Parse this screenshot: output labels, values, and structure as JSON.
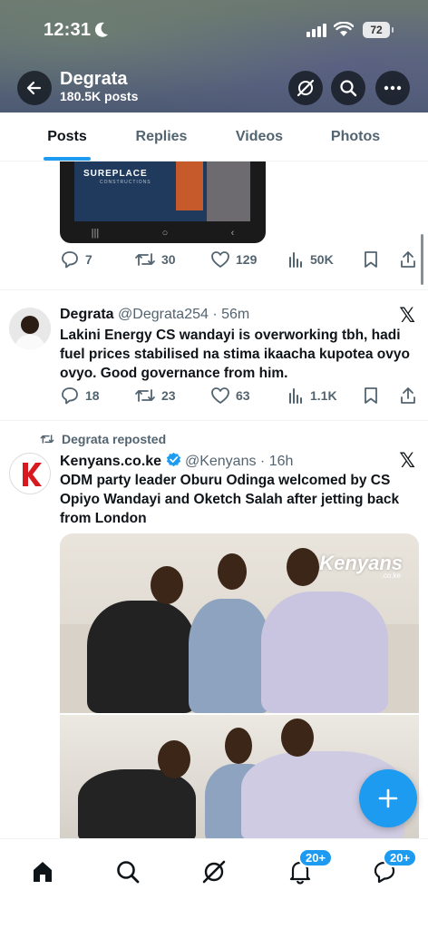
{
  "status_bar": {
    "time": "12:31",
    "battery": "72"
  },
  "profile": {
    "name": "Degrata",
    "posts_count": "180.5K posts"
  },
  "tabs": [
    {
      "label": "Posts",
      "active": true
    },
    {
      "label": "Replies",
      "active": false
    },
    {
      "label": "Videos",
      "active": false
    },
    {
      "label": "Photos",
      "active": false
    }
  ],
  "posts": [
    {
      "embed_brand": "SUREPLACE",
      "embed_sub": "CONSTRUCTIONS",
      "replies": "7",
      "reposts": "30",
      "likes": "129",
      "views": "50K"
    },
    {
      "name": "Degrata",
      "handle": "@Degrata254 · 56m",
      "text": "Lakini Energy CS wandayi is overworking tbh, hadi fuel prices stabilised na stima ikaacha kupotea ovyo ovyo. Good governance from him.",
      "replies": "18",
      "reposts": "23",
      "likes": "63",
      "views": "1.1K"
    },
    {
      "repost_label": "Degrata reposted",
      "name": "Kenyans.co.ke",
      "handle": "@Kenyans · 16h",
      "text": "ODM party leader Oburu Odinga welcomed by CS Opiyo Wandayi and Oketch Salah after jetting back from London",
      "watermark": "Kenyans",
      "watermark_sub": ".co.ke"
    }
  ],
  "bottom_nav": {
    "notifications_badge": "20+",
    "messages_badge": "20+"
  },
  "colors": {
    "accent": "#1d9bf0",
    "text": "#0f1419",
    "muted": "#536471"
  },
  "icons": [
    "back-arrow-icon",
    "grok-icon",
    "search-icon",
    "more-icon",
    "reply-icon",
    "repost-icon",
    "like-icon",
    "views-icon",
    "bookmark-icon",
    "share-icon",
    "x-logo-icon",
    "verified-icon",
    "compose-icon",
    "home-icon",
    "bell-icon",
    "messages-icon"
  ]
}
